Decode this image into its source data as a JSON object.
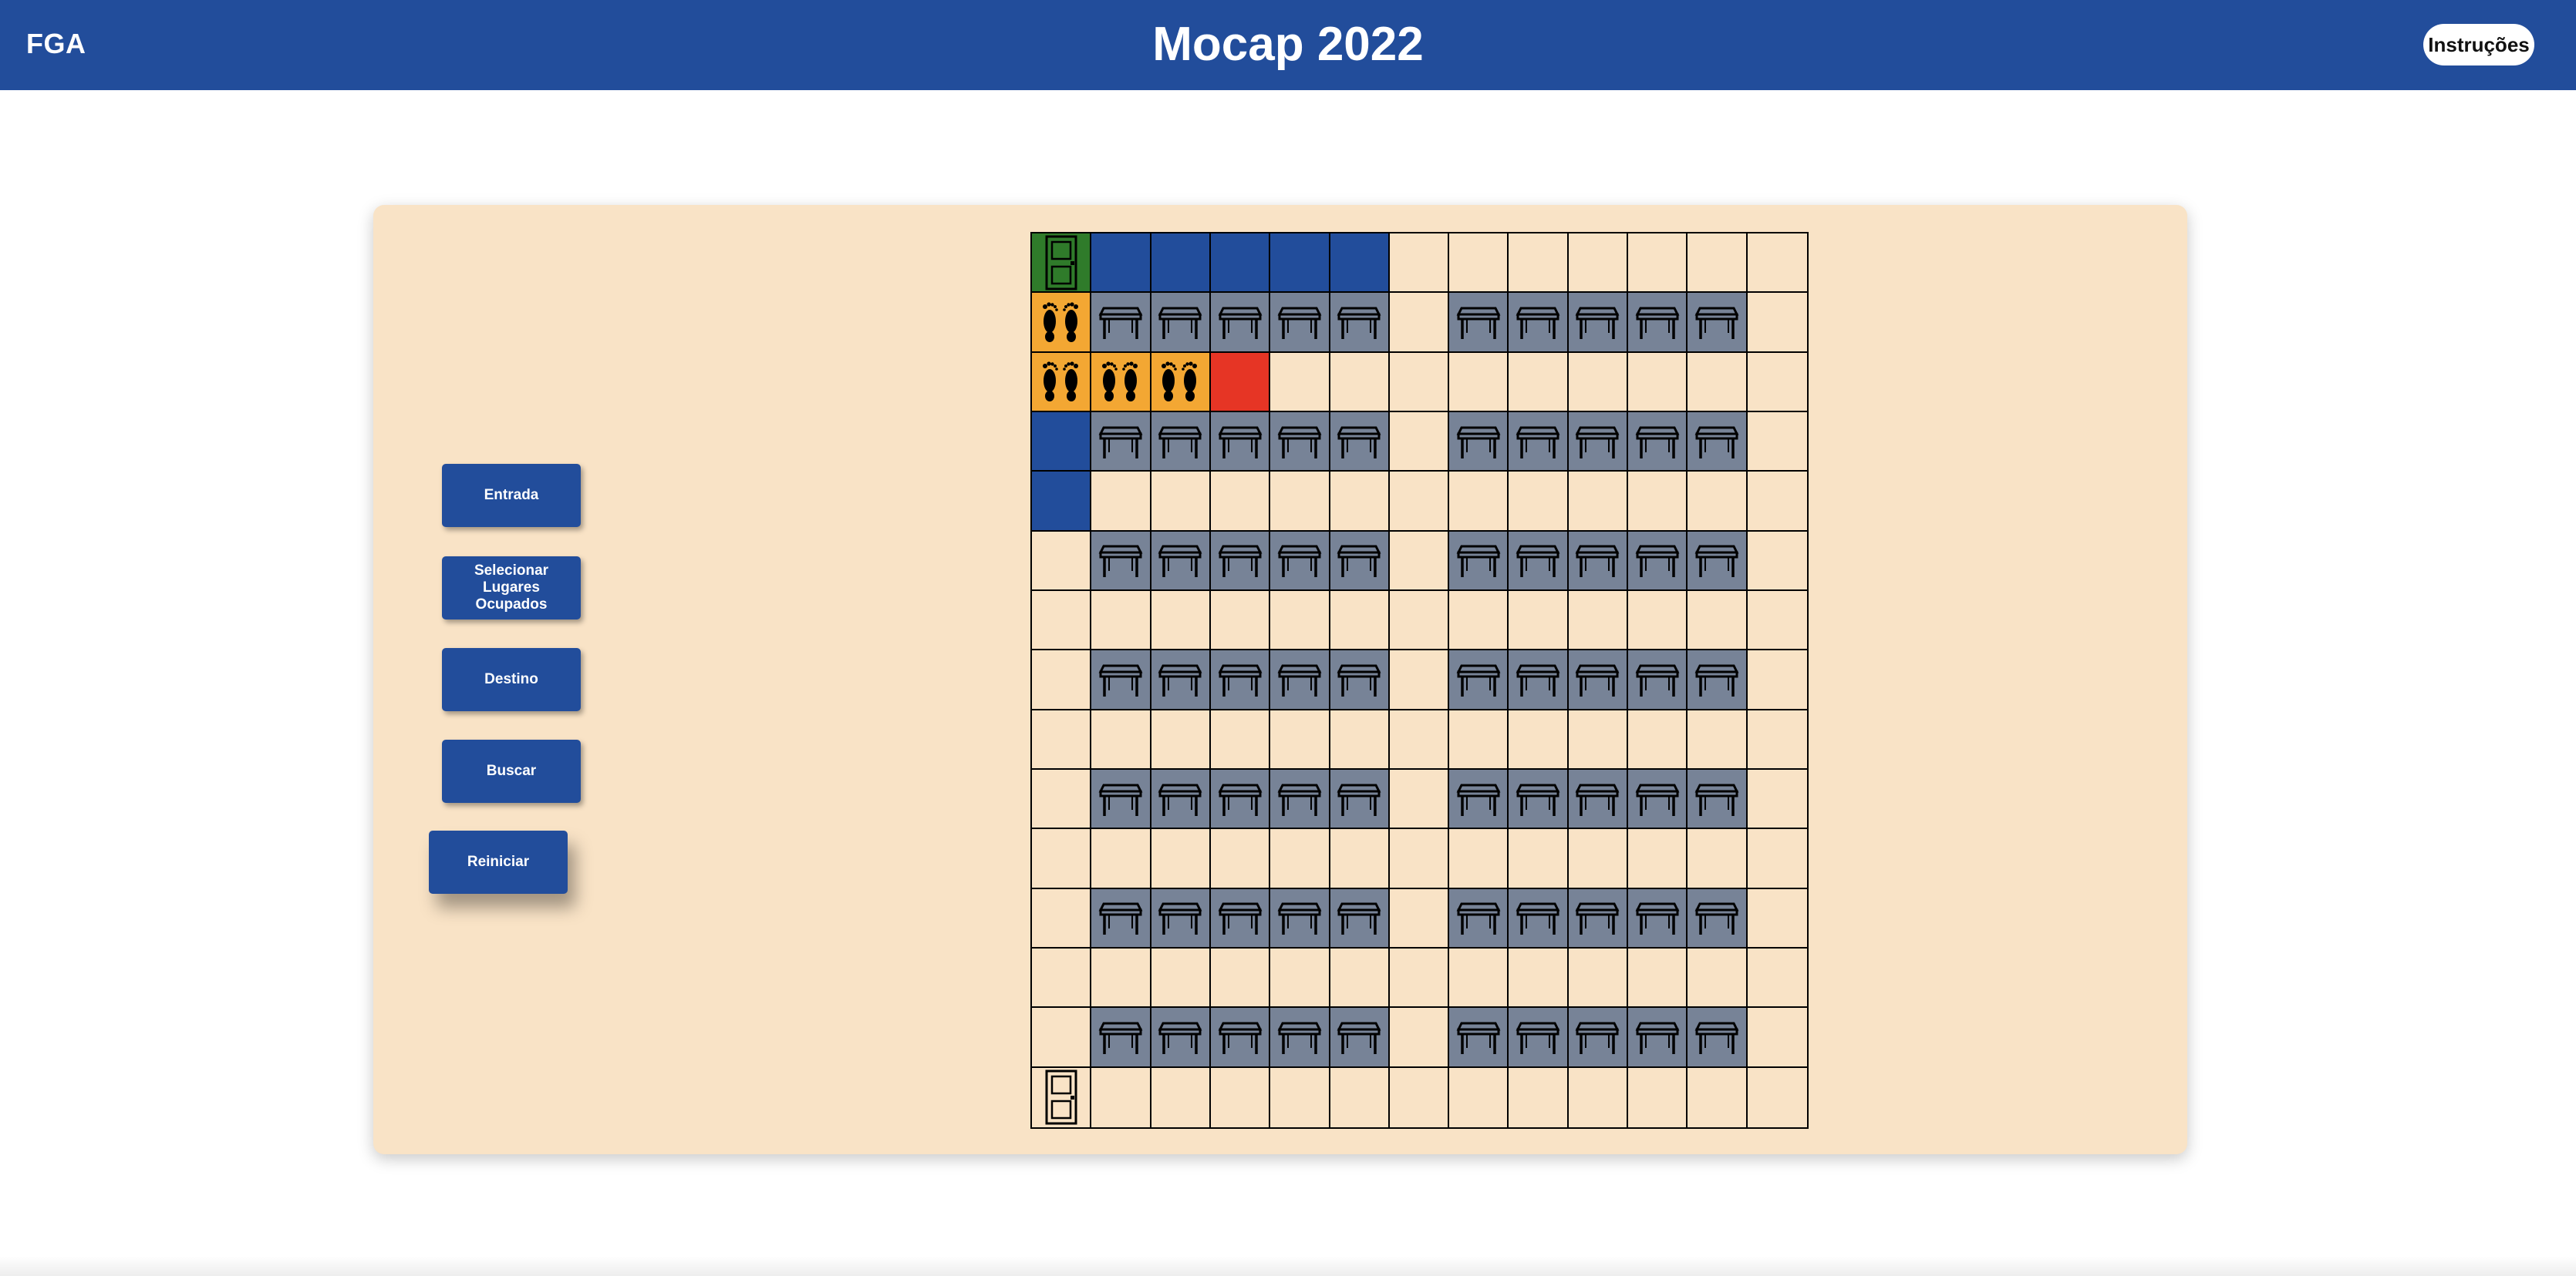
{
  "header": {
    "brand": "FGA",
    "title": "Mocap 2022",
    "help_button": "Instruções"
  },
  "controls": [
    {
      "id": "entrada",
      "label": "Entrada"
    },
    {
      "id": "selecionar",
      "label": "Selecionar Lugares Ocupados"
    },
    {
      "id": "destino",
      "label": "Destino"
    },
    {
      "id": "buscar",
      "label": "Buscar"
    },
    {
      "id": "reiniciar",
      "label": "Reiniciar"
    }
  ],
  "colors": {
    "header": "#224d9b",
    "panel": "#f9e3c6",
    "empty": "#f9e3c6",
    "blocked": "#224d9b",
    "seat": "#778397",
    "path": "#f3a733",
    "destination": "#e63525",
    "entrance": "#2f7b2a"
  },
  "legend": {
    "E": "door-icon",
    "D": "door-icon",
    "B": "blocked-cell",
    "T": "table-icon",
    "P": "footprints-icon",
    "X": "destination-cell",
    ".": "empty-cell"
  },
  "grid": {
    "rows": 15,
    "cols": 13,
    "cells": [
      "EBBBBB.......",
      "PTTTTT.TTTTT.",
      "PPPX.........",
      "BTTTTT.TTTTT.",
      "B............",
      ".TTTTT.TTTTT.",
      ".............",
      ".TTTTT.TTTTT.",
      ".............",
      ".TTTTT.TTTTT.",
      ".............",
      ".TTTTT.TTTTT.",
      ".............",
      ".TTTTT.TTTTT.",
      "D............"
    ]
  }
}
